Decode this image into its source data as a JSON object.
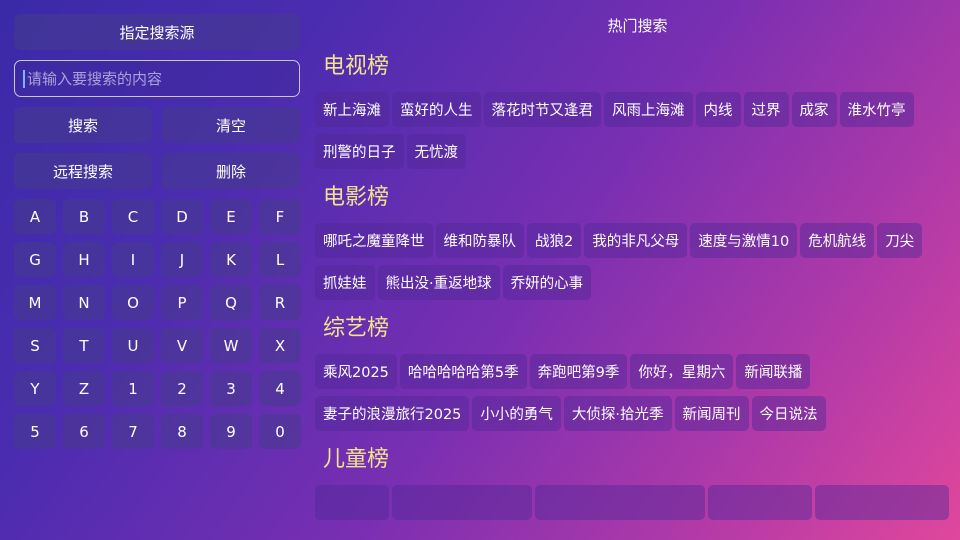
{
  "left": {
    "source_button": "指定搜索源",
    "search_placeholder": "请输入要搜索的内容",
    "search_value": "",
    "search_button": "搜索",
    "clear_button": "清空",
    "remote_search_button": "远程搜索",
    "delete_button": "删除",
    "keys": [
      "A",
      "B",
      "C",
      "D",
      "E",
      "F",
      "G",
      "H",
      "I",
      "J",
      "K",
      "L",
      "M",
      "N",
      "O",
      "P",
      "Q",
      "R",
      "S",
      "T",
      "U",
      "V",
      "W",
      "X",
      "Y",
      "Z",
      "1",
      "2",
      "3",
      "4",
      "5",
      "6",
      "7",
      "8",
      "9",
      "0"
    ]
  },
  "right": {
    "title": "热门搜索",
    "sections": [
      {
        "title": "电视榜",
        "items": [
          "新上海滩",
          "蛮好的人生",
          "落花时节又逢君",
          "风雨上海滩",
          "内线",
          "过界",
          "成家",
          "淮水竹亭",
          "刑警的日子",
          "无忧渡"
        ]
      },
      {
        "title": "电影榜",
        "items": [
          "哪吒之魔童降世",
          "维和防暴队",
          "战狼2",
          "我的非凡父母",
          "速度与激情10",
          "危机航线",
          "刀尖",
          "抓娃娃",
          "熊出没·重返地球",
          "乔妍的心事"
        ]
      },
      {
        "title": "综艺榜",
        "items": [
          "乘风2025",
          "哈哈哈哈哈第5季",
          "奔跑吧第9季",
          "你好，星期六",
          "新闻联播",
          "妻子的浪漫旅行2025",
          "小小的勇气",
          "大侦探·拾光季",
          "新闻周刊",
          "今日说法"
        ]
      },
      {
        "title": "儿童榜",
        "items": [
          "",
          "",
          "",
          "",
          ""
        ]
      }
    ]
  }
}
